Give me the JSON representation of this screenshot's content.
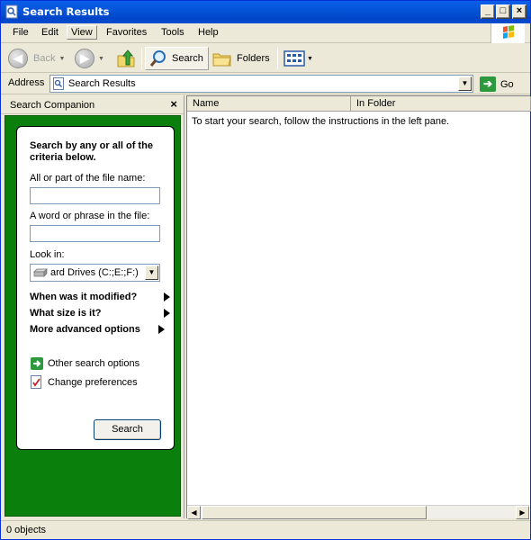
{
  "window": {
    "title": "Search Results"
  },
  "menubar": {
    "items": [
      "File",
      "Edit",
      "View",
      "Favorites",
      "Tools",
      "Help"
    ],
    "active": "View"
  },
  "toolbar": {
    "back_label": "Back",
    "search_label": "Search",
    "folders_label": "Folders"
  },
  "address": {
    "label": "Address",
    "value": "Search Results",
    "go_label": "Go"
  },
  "side": {
    "title": "Search Companion",
    "heading": "Search by any or all of the criteria below.",
    "filename_label": "All or part of the file name:",
    "filename_value": "",
    "phrase_label": "A word or phrase in the file:",
    "phrase_value": "",
    "lookin_label": "Look in:",
    "lookin_value": "ard Drives (C:;E:;F:)",
    "expanders": [
      "When was it modified?",
      "What size is it?",
      "More advanced options"
    ],
    "links": [
      "Other search options",
      "Change preferences"
    ],
    "search_button": "Search"
  },
  "results": {
    "columns": [
      "Name",
      "In Folder"
    ],
    "empty_message": "To start your search, follow the instructions in the left pane."
  },
  "status": {
    "text": "0 objects"
  }
}
